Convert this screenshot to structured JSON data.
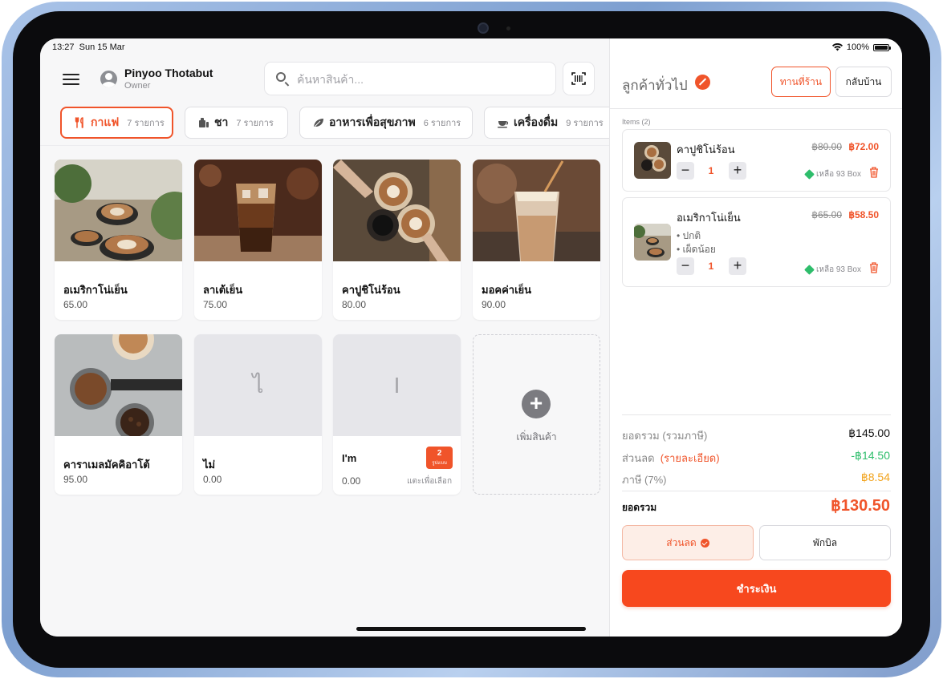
{
  "status": {
    "time": "13:27",
    "date": "Sun 15 Mar",
    "battery": "100%"
  },
  "user": {
    "name": "Pinyoo Thotabut",
    "role": "Owner"
  },
  "search": {
    "placeholder": "ค้นหาสินค้า..."
  },
  "categories": [
    {
      "label": "กาแฟ",
      "count": "7 รายการ",
      "icon": "fork-knife-icon",
      "active": true
    },
    {
      "label": "ชา",
      "count": "7 รายการ",
      "icon": "tea-icon",
      "active": false
    },
    {
      "label": "อาหารเพื่อสุขภาพ",
      "count": "6 รายการ",
      "icon": "leaf-icon",
      "active": false
    },
    {
      "label": "เครื่องดื่ม",
      "count": "9 รายการ",
      "icon": "cup-icon",
      "active": false
    }
  ],
  "products": [
    {
      "name": "อเมริกาโน่เย็น",
      "price": "65.00"
    },
    {
      "name": "ลาเต้เย็น",
      "price": "75.00"
    },
    {
      "name": "คาปูชิโน่ร้อน",
      "price": "80.00"
    },
    {
      "name": "มอคค่าเย็น",
      "price": "90.00"
    },
    {
      "name": "คาราเมลมัคคิอาโต้",
      "price": "95.00"
    },
    {
      "name": "ไม่",
      "price": "0.00",
      "placeholder": "ไ"
    },
    {
      "name": "I'm",
      "price": "0.00",
      "placeholder": "I",
      "variants": "2",
      "variants_label": "รูปแบบ",
      "hint": "แตะเพื่อเลือก"
    }
  ],
  "add_product": {
    "label": "เพิ่มสินค้า"
  },
  "order": {
    "customer": "ลูกค้าทั่วไป",
    "dine_in": "ทานที่ร้าน",
    "takeaway": "กลับบ้าน",
    "items_label": "Items (2)",
    "items": [
      {
        "name": "คาปูชิโน่ร้อน",
        "old_price": "฿80.00",
        "price": "฿72.00",
        "qty": "1",
        "stock": "เหลือ 93 Box",
        "options": []
      },
      {
        "name": "อเมริกาโน่เย็น",
        "old_price": "฿65.00",
        "price": "฿58.50",
        "qty": "1",
        "stock": "เหลือ 93 Box",
        "options": [
          "• ปกติ",
          "• เผ็ดน้อย"
        ]
      }
    ]
  },
  "summary": {
    "subtotal_label": "ยอดรวม (รวมภาษี)",
    "subtotal": "฿145.00",
    "discount_label": "ส่วนลด",
    "discount_detail": "(รายละเอียด)",
    "discount": "-฿14.50",
    "tax_label": "ภาษี (7%)",
    "tax": "฿8.54",
    "total_label": "ยอดรวม",
    "total": "฿130.50"
  },
  "actions": {
    "discount": "ส่วนลด",
    "hold": "พักบิล",
    "pay": "ชำระเงิน"
  },
  "colors": {
    "accent": "#f0542a",
    "success": "#2ebd6b",
    "tax": "#f2a31c",
    "discount": "#2ebd6b"
  }
}
